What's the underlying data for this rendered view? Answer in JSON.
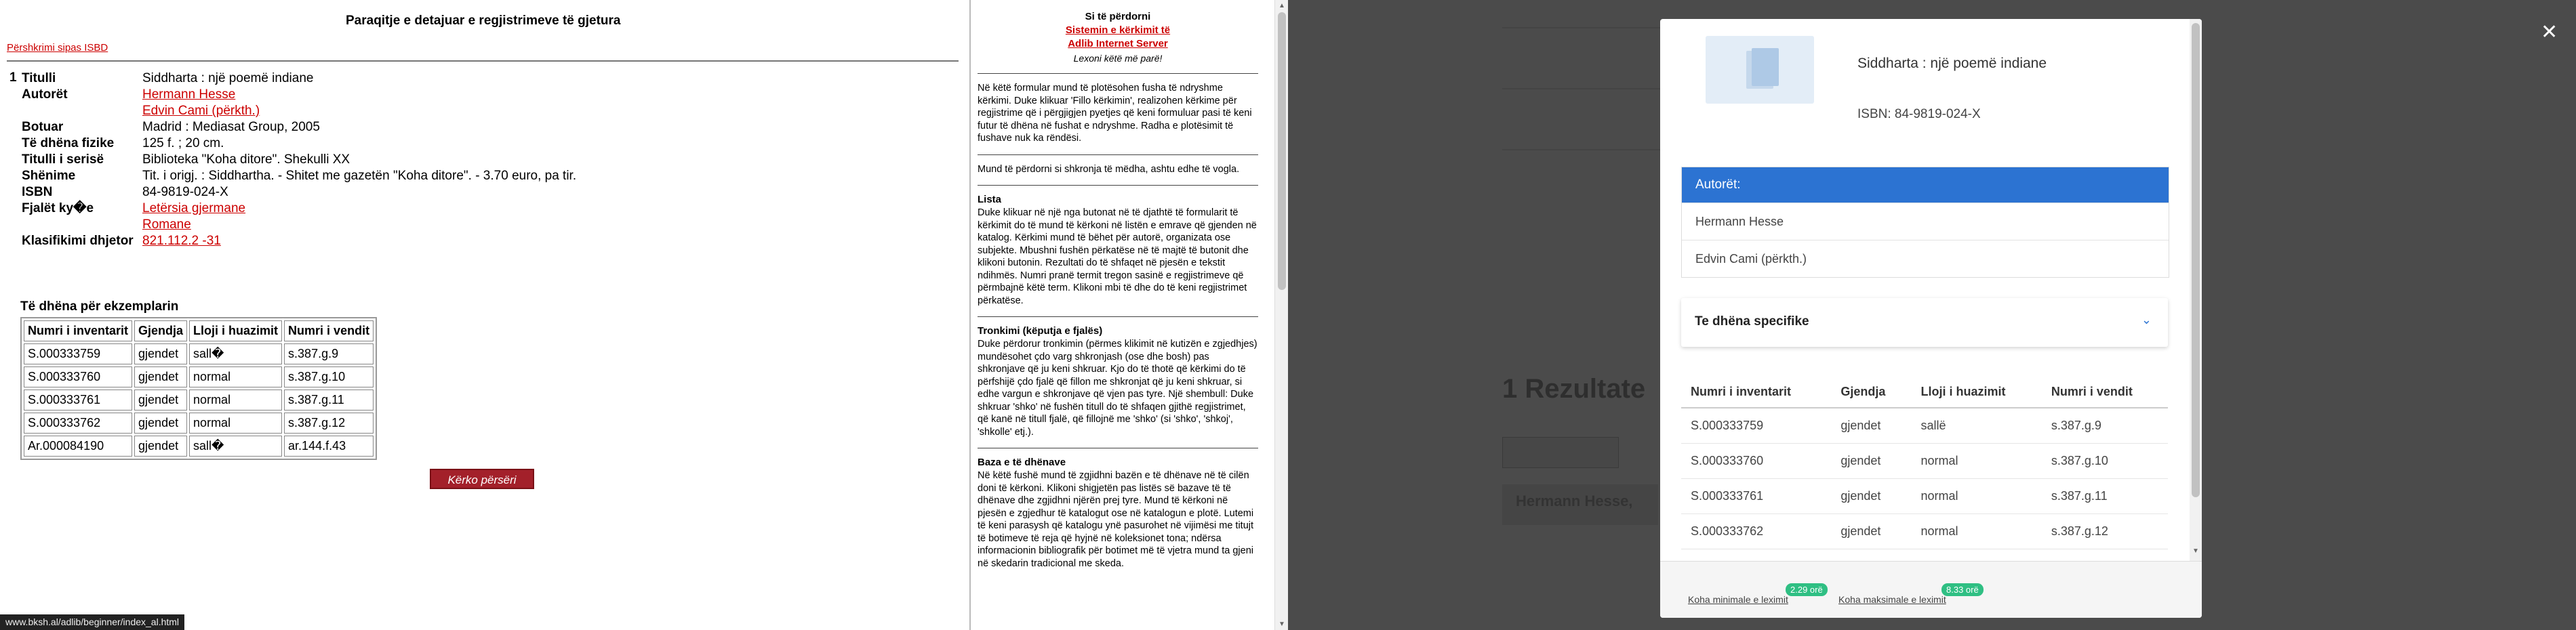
{
  "left": {
    "title": "Paraqitje e detajuar e regjistrimeve të gjetura",
    "isbd_link": "Përshkrimi sipas ISBD",
    "record_number": "1",
    "fields": [
      {
        "label": "Titulli",
        "values": [
          "Siddharta : një poemë indiane"
        ],
        "link": false
      },
      {
        "label": "Autorët",
        "values": [
          "Hermann Hesse",
          "Edvin Cami (përkth.)"
        ],
        "link": true
      },
      {
        "label": "Botuar",
        "values": [
          "Madrid : Mediasat Group, 2005"
        ],
        "link": false
      },
      {
        "label": "Të dhëna fizike",
        "values": [
          "125 f. ; 20 cm."
        ],
        "link": false
      },
      {
        "label": "Titulli i serisë",
        "values": [
          "Biblioteka \"Koha ditore\". Shekulli XX"
        ],
        "link": false
      },
      {
        "label": "Shënime",
        "values": [
          "Tit. i origj. : Siddhartha. - Shitet me gazetën \"Koha ditore\". - 3.70 euro, pa tir."
        ],
        "link": false
      },
      {
        "label": "ISBN",
        "values": [
          "84-9819-024-X"
        ],
        "link": false
      },
      {
        "label": "Fjalët ky�e",
        "values": [
          "Letërsia gjermane",
          "Romane"
        ],
        "link": true
      },
      {
        "label": "Klasifikimi dhjetor",
        "values": [
          "821.112.2 -31"
        ],
        "link": true
      }
    ],
    "copies_title": "Të dhëna për ekzemplarin",
    "copies_headers": [
      "Numri i inventarit",
      "Gjendja",
      "Lloji i huazimit",
      "Numri i vendit"
    ],
    "copies_rows": [
      [
        "S.000333759",
        "gjendet",
        "sall�",
        "s.387.g.9"
      ],
      [
        "S.000333760",
        "gjendet",
        "normal",
        "s.387.g.10"
      ],
      [
        "S.000333761",
        "gjendet",
        "normal",
        "s.387.g.11"
      ],
      [
        "S.000333762",
        "gjendet",
        "normal",
        "s.387.g.12"
      ],
      [
        "Ar.000084190",
        "gjendet",
        "sall�",
        "ar.144.f.43"
      ]
    ],
    "search_again_button": "Kërko përsëri",
    "status_url": "www.bksh.al/adlib/beginner/index_al.html"
  },
  "help": {
    "heading": "Si të përdorni",
    "link1": "Sistemin e kërkimit të",
    "link2": "Adlib Internet Server",
    "subtitle": "Lexoni këtë më parë!",
    "intro": "Në këtë formular mund të plotësohen fusha të ndryshme kërkimi. Duke klikuar 'Fillo kërkimin', realizohen kërkime për regjistrime që i përgjigjen pyetjes që keni formuluar pasi të keni futur të dhëna në fushat e ndryshme. Radha e plotësimit të fushave nuk ka rëndësi.",
    "case_note": "Mund të përdorni si shkronja të mëdha, ashtu edhe të vogla.",
    "sections": [
      {
        "title": "Lista",
        "text": "Duke klikuar në një nga butonat në të djathtë të formularit të kërkimit do të mund të kërkoni në listën e emrave që gjenden në katalog. Kërkimi mund të bëhet për autorë, organizata ose subjekte. Mbushni fushën përkatëse në të majtë të butonit dhe klikoni butonin. Rezultati do të shfaqet në pjesën e tekstit ndihmës. Numri pranë termit tregon sasinë e regjistrimeve që përmbajnë këtë term. Klikoni mbi të dhe do të keni regjistrimet përkatëse."
      },
      {
        "title": "Tronkimi (këputja e fjalës)",
        "text": "Duke përdorur tronkimin (përmes klikimit në kutizën e zgjedhjes) mundësohet çdo varg shkronjash (ose dhe bosh) pas shkronjave që ju keni shkruar. Kjo do të thotë që kërkimi do të përfshijë çdo fjalë që fillon me shkronjat që ju keni shkruar, si edhe vargun e shkronjave që vjen pas tyre. Një shembull: Duke shkruar 'shko' në fushën titull do të shfaqen gjithë regjistrimet, që kanë në titull fjalë, që fillojnë me 'shko' (si 'shko', 'shkoj', 'shkolle' etj.)."
      },
      {
        "title": "Baza e të dhënave",
        "text": "Në këtë fushë mund të zgjidhni bazën e të dhënave në të cilën doni të kërkoni. Klikoni shigjetën pas listës së bazave të të dhënave dhe zgjidhni njërën prej tyre. Mund të kërkoni në pjesën e zgjedhur të katalogut ose në katalogun e plotë. Lutemi të keni parasysh që katalogu ynë pasurohet në vijimësi me titujt të botimeve të reja që hyjnë në koleksionet tona; ndërsa informacionin bibliografik për botimet më të vjetra mund ta gjeni në skedarin tradicional me skeda."
      }
    ]
  },
  "modal": {
    "title": "Siddharta : një poemë indiane",
    "isbn": "ISBN: 84-9819-024-X",
    "authors_header": "Autorët:",
    "authors": [
      "Hermann Hesse",
      "Edvin Cami (përkth.)"
    ],
    "specific_label": "Te dhëna specifike",
    "table_headers": [
      "Numri i inventarit",
      "Gjendja",
      "Lloji i huazimit",
      "Numri i vendit"
    ],
    "table_rows": [
      [
        "S.000333759",
        "gjendet",
        "sallë",
        "s.387.g.9"
      ],
      [
        "S.000333760",
        "gjendet",
        "normal",
        "s.387.g.10"
      ],
      [
        "S.000333761",
        "gjendet",
        "normal",
        "s.387.g.11"
      ],
      [
        "S.000333762",
        "gjendet",
        "normal",
        "s.387.g.12"
      ]
    ],
    "footer_min_label": "Koha minimale e leximit",
    "footer_min_badge": "2.29 orë",
    "footer_max_label": "Koha maksimale e leximit",
    "footer_max_badge": "8.33 orë"
  },
  "background": {
    "results_title": "1 Rezultate",
    "result_author": "Hermann Hesse,"
  },
  "colors": {
    "link_red": "#cc0000",
    "button_red": "#a3202a",
    "modal_blue": "#2c73d2",
    "badge_green": "#2fbf83",
    "overlay": "#4b4b4b"
  }
}
